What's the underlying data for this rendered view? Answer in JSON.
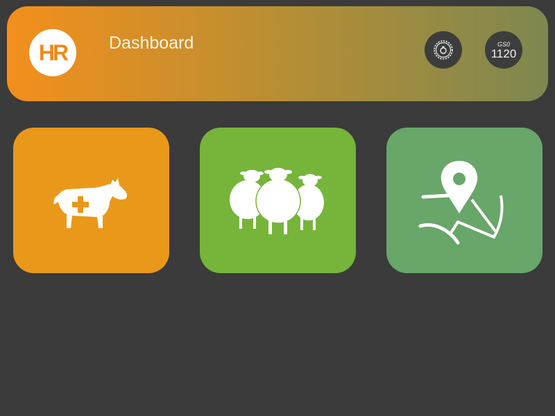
{
  "header": {
    "logo_text": "HR",
    "title": "Dashboard",
    "settings_icon": "gear-icon",
    "points": {
      "label": "GS0",
      "value": "1120"
    }
  },
  "tiles": [
    {
      "name": "animal-health",
      "icon": "cow-medical-cross-icon",
      "color": "#ea981a"
    },
    {
      "name": "herd",
      "icon": "sheep-flock-icon",
      "color": "#76b43a"
    },
    {
      "name": "map",
      "icon": "location-pin-path-icon",
      "color": "#68a66a"
    }
  ],
  "colors": {
    "background": "#3a3b3a",
    "header_gradient_start": "#f38f1c",
    "header_gradient_end": "#7d8750"
  }
}
